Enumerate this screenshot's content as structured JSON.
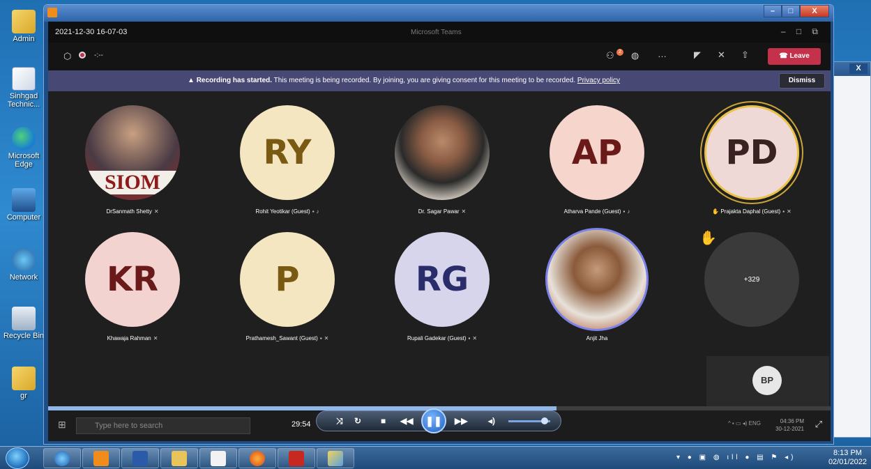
{
  "desktop": {
    "icons": [
      {
        "label": "Admin"
      },
      {
        "label": "Sinhgad Technic..."
      },
      {
        "label": "Microsoft Edge"
      },
      {
        "label": "Computer"
      },
      {
        "label": "Network"
      },
      {
        "label": "Recycle Bin"
      },
      {
        "label": "gr"
      }
    ]
  },
  "player": {
    "time_elapsed": "29:54",
    "close_label": "X"
  },
  "teams": {
    "timestamp": "2021-12-30 16-07-03",
    "window_title": "Microsoft Teams",
    "meeting_timer": "-:--",
    "participants_badge": "2",
    "leave_label": "Leave",
    "recording_banner": {
      "bold": "Recording has started.",
      "text": "This meeting is being recorded. By joining, you are giving consent for this meeting to be recorded.",
      "link": "Privacy policy",
      "dismiss": "Dismiss"
    },
    "participants": [
      {
        "name": "DrSanmath Shetty",
        "initials": "",
        "photo": true
      },
      {
        "name": "Rohit Yeotikar (Guest)",
        "initials": "RY"
      },
      {
        "name": "Dr. Sagar Pawar",
        "initials": "",
        "photo": true
      },
      {
        "name": "Atharva Pande (Guest)",
        "initials": "AP"
      },
      {
        "name": "Prajakta Daphal (Guest)",
        "initials": "PD"
      },
      {
        "name": "Khawaja Rahman",
        "initials": "KR"
      },
      {
        "name": "Prathamesh_Sawant (Guest)",
        "initials": "P"
      },
      {
        "name": "Rupali Gadekar (Guest)",
        "initials": "RG"
      },
      {
        "name": "Anjit Jha",
        "initials": "",
        "photo": true
      },
      {
        "name": "",
        "initials": "+329"
      }
    ],
    "self_view_initials": "BP"
  },
  "inner_taskbar": {
    "search_placeholder": "Type here to search",
    "lang": "ENG",
    "time": "04:36 PM",
    "date": "30-12-2021"
  },
  "taskbar": {
    "time": "8:13 PM",
    "date": "02/01/2022"
  },
  "colors": {
    "leave": "#c4314b",
    "banner": "#474874",
    "ry_bg": "#f5e6c2",
    "ap_bg": "#f5d5cc",
    "pd_bg": "#efd9d6",
    "kr_bg": "#f2d3d0",
    "p_bg": "#f5e6c2",
    "rg_bg": "#d6d5ec"
  }
}
